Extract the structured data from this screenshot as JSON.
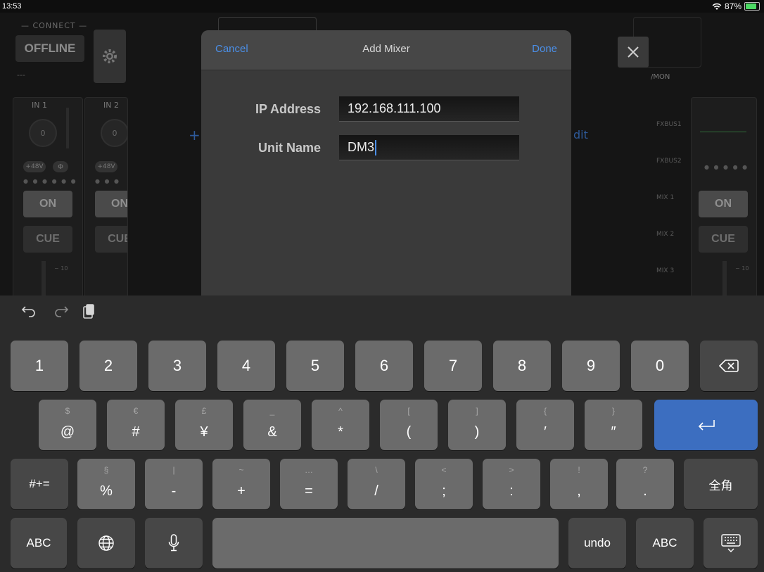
{
  "status_bar": {
    "time": "13:53",
    "battery_pct": "87%"
  },
  "background": {
    "connect_label": "— CONNECT —",
    "offline_label": "OFFLINE",
    "dashes": "---",
    "channels": [
      {
        "name": "IN 1",
        "knob_value": "0",
        "phantom": "+48V",
        "phase": "Φ",
        "on_label": "ON",
        "cue_label": "CUE",
        "fader_mark": "− 10"
      },
      {
        "name": "IN 2",
        "knob_value": "0",
        "phantom": "+48V",
        "phase": "",
        "on_label": "ON",
        "cue_label": "CUE",
        "fader_mark": ""
      }
    ],
    "mon_label": "/MON",
    "bus_labels": [
      "FXBUS1",
      "FXBUS2",
      "MIX 1",
      "MIX 2",
      "MIX 3"
    ],
    "right_strip": {
      "on_label": "ON",
      "cue_label": "CUE",
      "fader_mark": "− 10"
    },
    "edit_text": "dit",
    "plus_text": "+"
  },
  "dialog": {
    "cancel_label": "Cancel",
    "title": "Add Mixer",
    "done_label": "Done",
    "ip_label": "IP Address",
    "ip_value": "192.168.111.100",
    "name_label": "Unit Name",
    "name_value": "DM3"
  },
  "keyboard": {
    "row1": [
      "1",
      "2",
      "3",
      "4",
      "5",
      "6",
      "7",
      "8",
      "9",
      "0"
    ],
    "row2": [
      {
        "alt": "$",
        "main": "@"
      },
      {
        "alt": "€",
        "main": "#"
      },
      {
        "alt": "£",
        "main": "¥"
      },
      {
        "alt": "_",
        "main": "&"
      },
      {
        "alt": "^",
        "main": "*"
      },
      {
        "alt": "[",
        "main": "("
      },
      {
        "alt": "]",
        "main": ")"
      },
      {
        "alt": "{",
        "main": "′"
      },
      {
        "alt": "}",
        "main": "″"
      }
    ],
    "row3": [
      {
        "alt": "§",
        "main": "%"
      },
      {
        "alt": "|",
        "main": "-"
      },
      {
        "alt": "~",
        "main": "+"
      },
      {
        "alt": "…",
        "main": "="
      },
      {
        "alt": "\\",
        "main": "/"
      },
      {
        "alt": "<",
        "main": ";"
      },
      {
        "alt": ">",
        "main": ":"
      },
      {
        "alt": "!",
        "main": ","
      },
      {
        "alt": "?",
        "main": "."
      }
    ],
    "symbols_key": "#+=",
    "zenkaku_key": "全角",
    "abc_left": "ABC",
    "undo_key": "undo",
    "abc_right": "ABC"
  },
  "colors": {
    "accent_blue": "#4b8fe8",
    "return_key": "#3c6ec0"
  }
}
